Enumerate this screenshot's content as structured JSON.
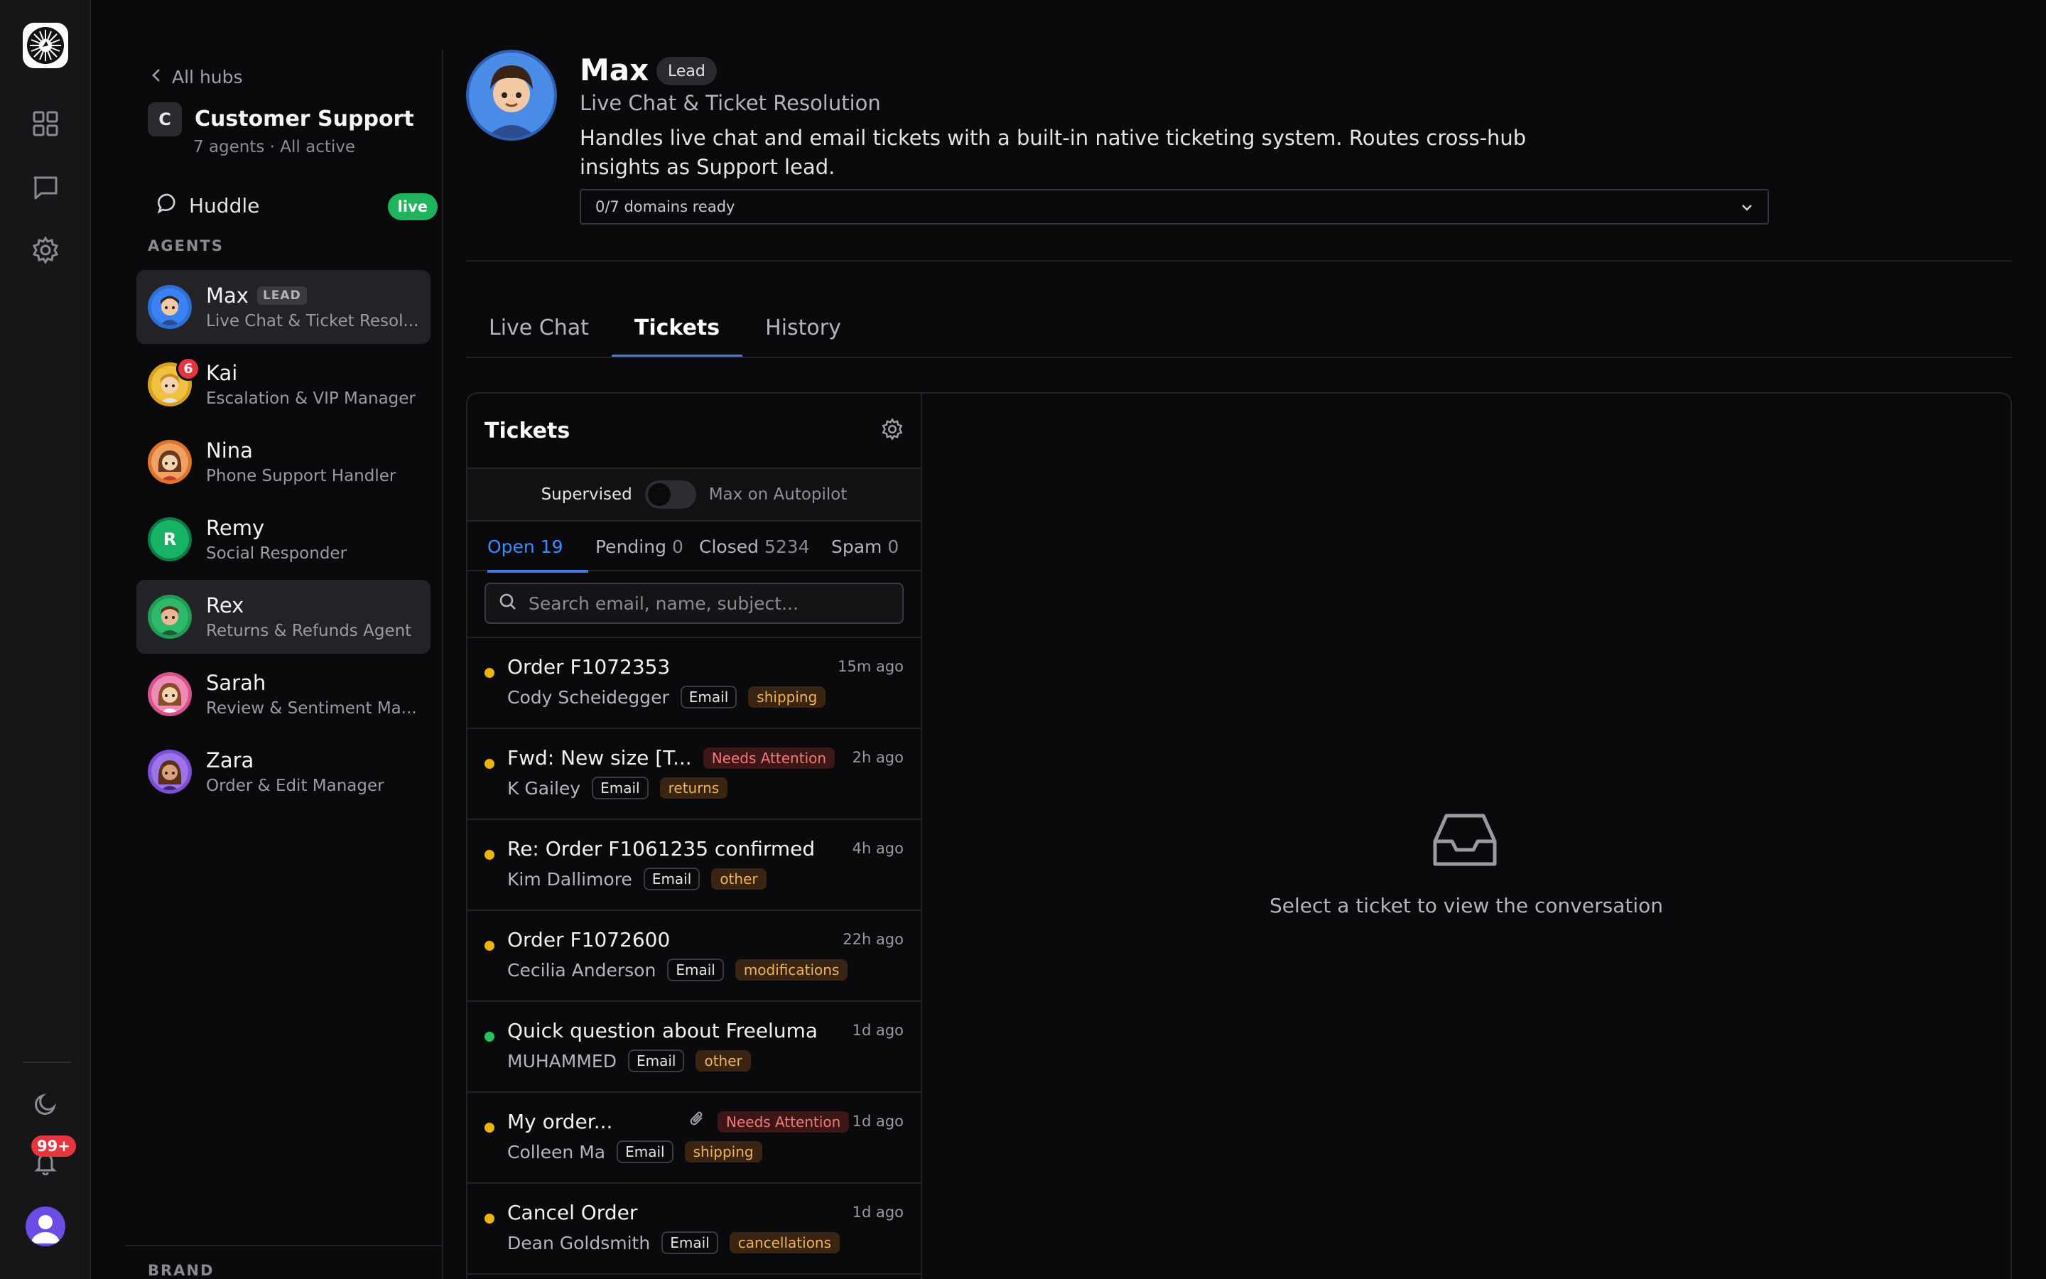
{
  "rail": {
    "notifications_badge": "99+",
    "icons": [
      "logo-icon",
      "grid-icon",
      "chat-icon",
      "gear-icon",
      "moon-icon",
      "bell-icon",
      "user-icon"
    ]
  },
  "hub": {
    "back_label": "All hubs",
    "letter": "C",
    "title": "Customer Support",
    "subtitle": "7 agents · All active",
    "huddle_label": "Huddle",
    "huddle_status": "live",
    "agents_heading": "AGENTS",
    "brand_heading": "BRAND",
    "agents": [
      {
        "name": "Max",
        "tag": "LEAD",
        "role": "Live Chat & Ticket Resol...",
        "color": "#2d6fd6",
        "badge": ""
      },
      {
        "name": "Kai",
        "tag": "",
        "role": "Escalation & VIP Manager",
        "color": "#d9a21c",
        "badge": "6"
      },
      {
        "name": "Nina",
        "tag": "",
        "role": "Phone Support Handler",
        "color": "#e0732c",
        "badge": ""
      },
      {
        "name": "Remy",
        "tag": "",
        "role": "Social Responder",
        "color": "#17b364",
        "badge": ""
      },
      {
        "name": "Rex",
        "tag": "",
        "role": "Returns & Refunds Agent",
        "color": "#1f9d55",
        "badge": ""
      },
      {
        "name": "Sarah",
        "tag": "",
        "role": "Review & Sentiment Ma...",
        "color": "#d9528e",
        "badge": ""
      },
      {
        "name": "Zara",
        "tag": "",
        "role": "Order & Edit Manager",
        "color": "#7b4fd6",
        "badge": ""
      }
    ],
    "remy_initial": "R"
  },
  "profile": {
    "name": "Max",
    "badge": "Lead",
    "role": "Live Chat & Ticket Resolution",
    "description": "Handles live chat and email tickets with a built-in native ticketing system. Routes cross-hub insights as Support lead.",
    "domains": "0/7 domains ready"
  },
  "tabs": [
    "Live Chat",
    "Tickets",
    "History"
  ],
  "tickets": {
    "title": "Tickets",
    "mode_left": "Supervised",
    "mode_right": "Max on Autopilot",
    "status_tabs": [
      {
        "label": "Open",
        "count": "19"
      },
      {
        "label": "Pending",
        "count": "0"
      },
      {
        "label": "Closed",
        "count": "5234"
      },
      {
        "label": "Spam",
        "count": "0"
      }
    ],
    "search_placeholder": "Search email, name, subject...",
    "items": [
      {
        "subject": "Order F1072353",
        "attention": "",
        "time": "15m ago",
        "customer": "Cody Scheidegger",
        "channel": "Email",
        "tag": "shipping",
        "dot": "#eab308",
        "attachment": false
      },
      {
        "subject": "Fwd: New size [T...",
        "attention": "Needs Attention",
        "time": "2h ago",
        "customer": "K Gailey",
        "channel": "Email",
        "tag": "returns",
        "dot": "#eab308",
        "attachment": false
      },
      {
        "subject": "Re: Order F1061235 confirmed",
        "attention": "",
        "time": "4h ago",
        "customer": "Kim Dallimore",
        "channel": "Email",
        "tag": "other",
        "dot": "#eab308",
        "attachment": false
      },
      {
        "subject": "Order F1072600",
        "attention": "",
        "time": "22h ago",
        "customer": "Cecilia Anderson",
        "channel": "Email",
        "tag": "modifications",
        "dot": "#eab308",
        "attachment": false
      },
      {
        "subject": "Quick question about Freeluma",
        "attention": "",
        "time": "1d ago",
        "customer": "MUHAMMED",
        "channel": "Email",
        "tag": "other",
        "dot": "#22c55e",
        "attachment": false
      },
      {
        "subject": "My order...",
        "attention": "Needs Attention",
        "time": "1d ago",
        "customer": "Colleen Ma",
        "channel": "Email",
        "tag": "shipping",
        "dot": "#eab308",
        "attachment": true
      },
      {
        "subject": "Cancel Order",
        "attention": "",
        "time": "1d ago",
        "customer": "Dean Goldsmith",
        "channel": "Email",
        "tag": "cancellations",
        "dot": "#eab308",
        "attachment": false
      }
    ]
  },
  "empty_state": {
    "text": "Select a ticket to view the conversation",
    "icon": "inbox-icon"
  }
}
